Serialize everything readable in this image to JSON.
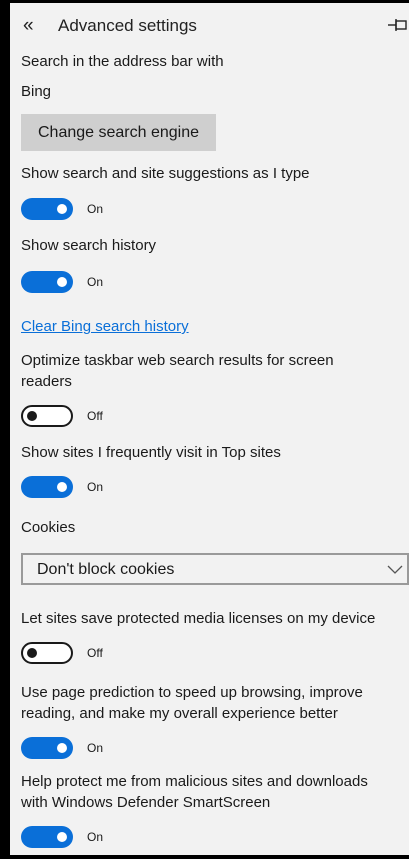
{
  "header": {
    "back_glyph": "«",
    "title": "Advanced settings"
  },
  "search": {
    "label": "Search in the address bar with",
    "value": "Bing",
    "change_button": "Change search engine"
  },
  "suggestions": {
    "label": "Show search and site suggestions as I type",
    "state": "On"
  },
  "history": {
    "label": "Show search history",
    "state": "On",
    "clear_link": "Clear Bing search history"
  },
  "taskbar": {
    "label_line1": "Optimize taskbar web search results for screen",
    "label_line2": "readers",
    "state": "Off"
  },
  "top_sites": {
    "label": "Show sites I frequently visit in Top sites",
    "state": "On"
  },
  "cookies": {
    "label": "Cookies",
    "selected": "Don't block cookies"
  },
  "media": {
    "label": "Let sites save protected media licenses on my device",
    "state": "Off"
  },
  "prediction": {
    "label_line1": "Use page prediction to speed up browsing, improve",
    "label_line2": "reading, and make my overall experience better",
    "state": "On"
  },
  "smartscreen": {
    "label_line1": "Help protect me from malicious sites and downloads",
    "label_line2": "with Windows Defender SmartScreen",
    "state": "On"
  },
  "colors": {
    "accent": "#0a6fd8",
    "background": "#f2f2f2",
    "button": "#cfcfcf"
  }
}
